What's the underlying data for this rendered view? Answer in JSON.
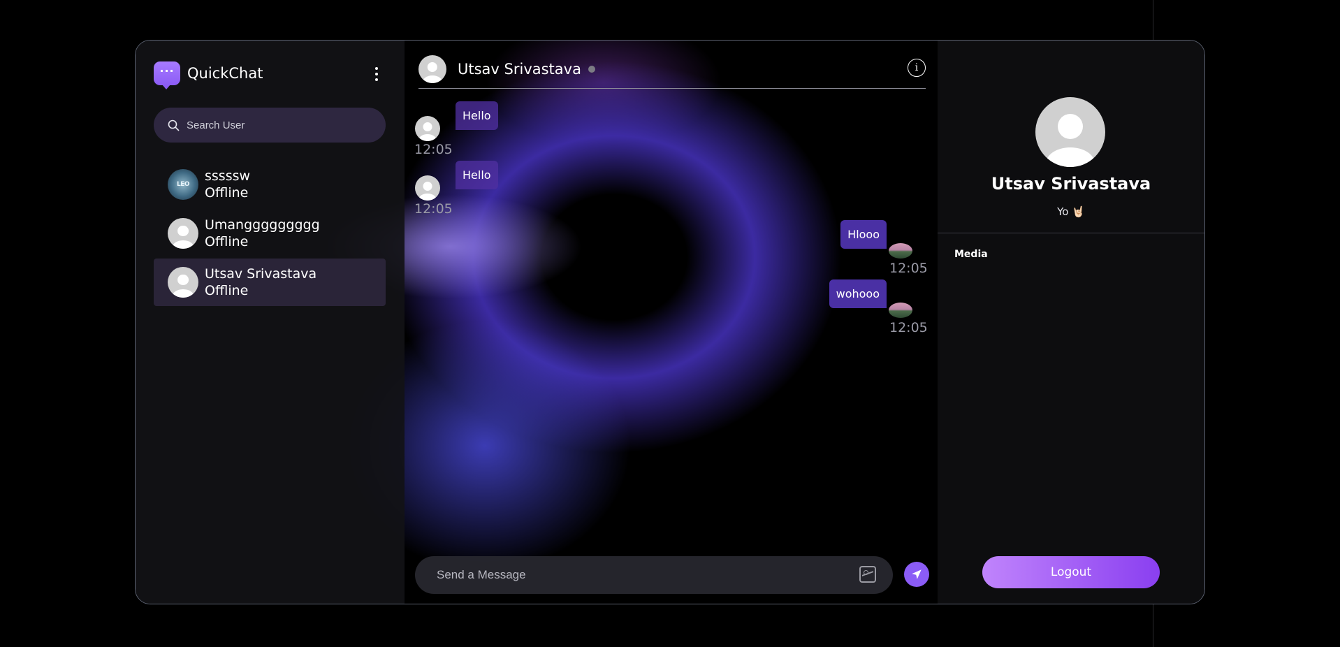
{
  "app": {
    "name": "QuickChat",
    "brand_glyph": "···"
  },
  "sidebar": {
    "search_placeholder": "Search User",
    "users": [
      {
        "name": "sssssw",
        "status": "Offline",
        "avatar": "leo-badge-icon",
        "avatar_text": "LEO"
      },
      {
        "name": "Umanggggggggg",
        "status": "Offline",
        "avatar": "user-avatar-icon"
      },
      {
        "name": "Utsav Srivastava",
        "status": "Offline",
        "avatar": "user-avatar-icon",
        "active": true
      }
    ]
  },
  "chat": {
    "contact_name": "Utsav Srivastava",
    "info_glyph": "i",
    "messages": [
      {
        "text": "Hello",
        "time": "12:05",
        "from": "them"
      },
      {
        "text": "Hello",
        "time": "12:05",
        "from": "them"
      },
      {
        "text": "Hlooo",
        "time": "12:05",
        "from": "me"
      },
      {
        "text": "wohooo",
        "time": "12:05",
        "from": "me"
      }
    ],
    "input_placeholder": "Send a Message"
  },
  "profile": {
    "name": "Utsav Srivastava",
    "bio": "Yo 🤘🏻",
    "media_label": "Media",
    "logout_label": "Logout"
  },
  "colors": {
    "accent": "#8b5cf6",
    "bubble_received": "#502fa0",
    "bubble_sent": "#5f3ed2",
    "search_bg": "#2e2740",
    "border": "#5b6170"
  }
}
